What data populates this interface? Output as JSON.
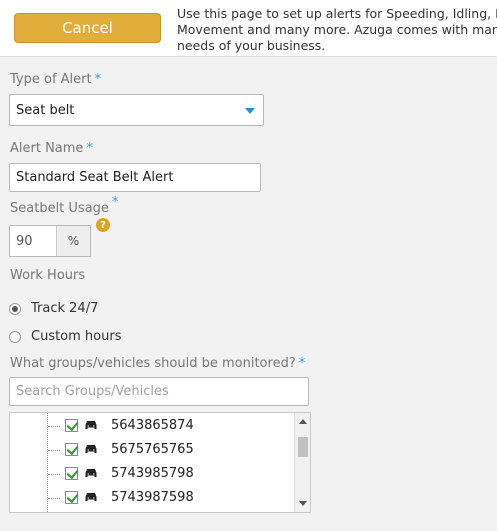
{
  "header": {
    "cancel_label": "Cancel",
    "intro_lines": [
      "Use this page to set up alerts for Speeding, Idling, Har",
      "Movement and many more. Azuga comes with many",
      "needs of your business."
    ]
  },
  "form": {
    "alert_type": {
      "label": "Type of Alert",
      "required_mark": "*",
      "value": "Seat belt"
    },
    "alert_name": {
      "label": "Alert Name",
      "required_mark": "*",
      "value": "Standard Seat Belt Alert"
    },
    "seatbelt_usage": {
      "label": "Seatbelt Usage",
      "required_mark": "*",
      "help_glyph": "?",
      "value": "90",
      "unit": "%"
    },
    "work_hours": {
      "label": "Work Hours",
      "options": [
        {
          "label": "Track 24/7",
          "selected": true
        },
        {
          "label": "Custom hours",
          "selected": false
        }
      ]
    },
    "groups": {
      "label": "What groups/vehicles should be monitored?",
      "required_mark": "*",
      "search_placeholder": "Search Groups/Vehicles",
      "vehicles": [
        {
          "id": "5643865874",
          "checked": true
        },
        {
          "id": "5675765765",
          "checked": true
        },
        {
          "id": "5743985798",
          "checked": true
        },
        {
          "id": "5743987598",
          "checked": true
        }
      ]
    }
  },
  "colors": {
    "cancel_button": "#e2ae3b",
    "required_mark": "#26a3d6",
    "help_icon": "#e2a121",
    "check": "#2a9a2a",
    "dropdown_caret": "#2d8fd4"
  },
  "icons": {
    "dropdown": "chevron-down-icon",
    "help": "help-icon",
    "vehicle": "car-icon",
    "check": "checkbox-icon"
  }
}
